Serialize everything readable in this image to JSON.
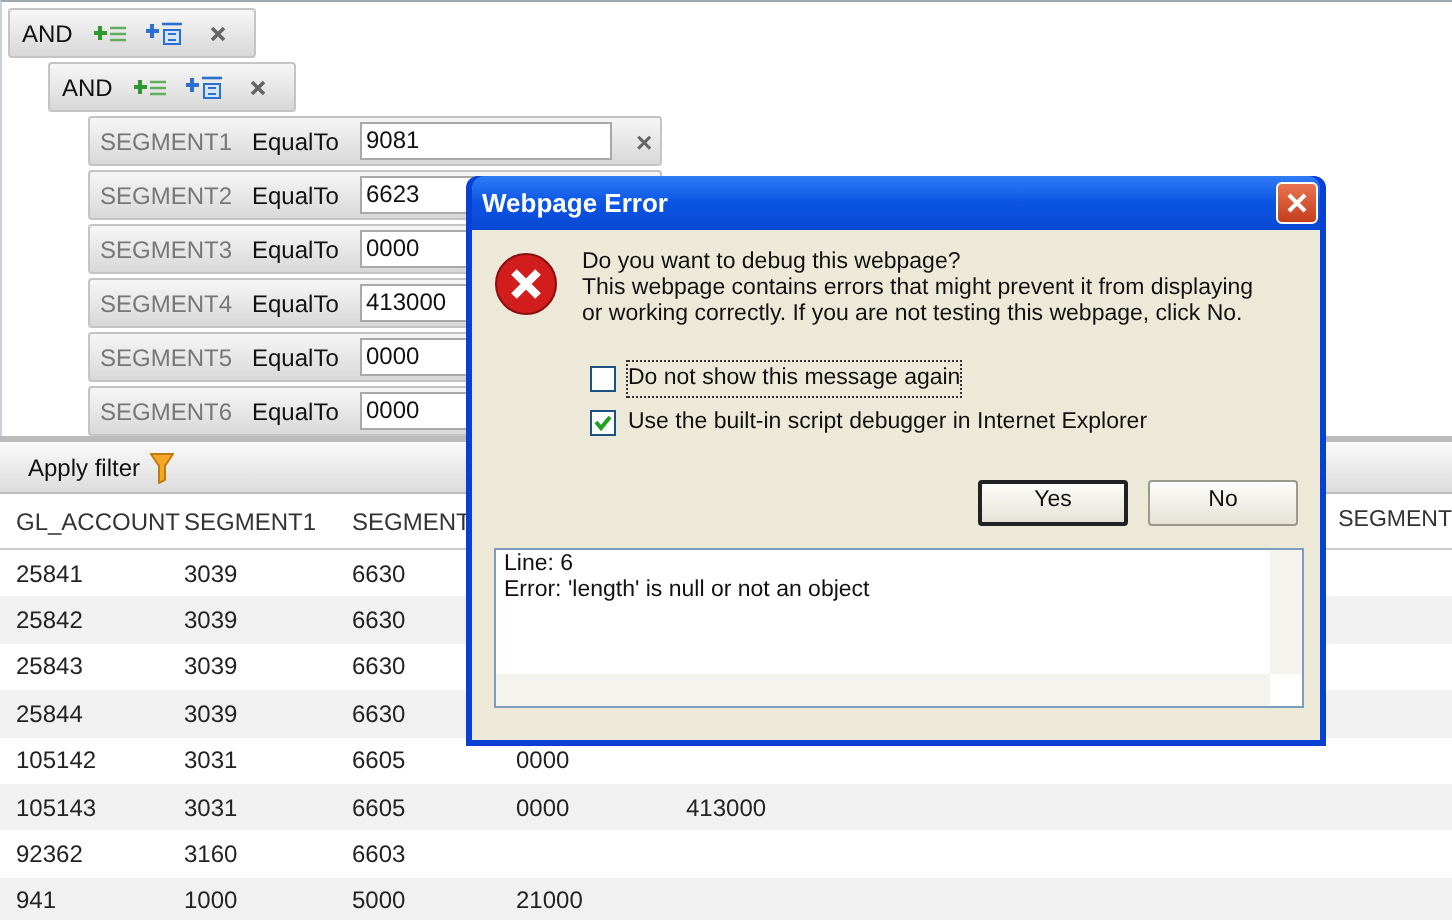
{
  "filter": {
    "operator": "AND",
    "children": [
      {
        "operator": "AND",
        "conditions": [
          {
            "field": "SEGMENT1",
            "operator": "EqualTo",
            "value": "9081",
            "delete": "×"
          },
          {
            "field": "SEGMENT2",
            "operator": "EqualTo",
            "value": "6623"
          },
          {
            "field": "SEGMENT3",
            "operator": "EqualTo",
            "value": "0000"
          },
          {
            "field": "SEGMENT4",
            "operator": "EqualTo",
            "value": "413000"
          },
          {
            "field": "SEGMENT5",
            "operator": "EqualTo",
            "value": "0000"
          },
          {
            "field": "SEGMENT6",
            "operator": "EqualTo",
            "value": "0000"
          }
        ]
      }
    ]
  },
  "toolbar": {
    "apply_label": "Apply filter"
  },
  "table": {
    "columns": [
      "GL_ACCOUNT",
      "SEGMENT1",
      "SEGMENT"
    ],
    "column_right": "SEGMENT",
    "rows": [
      [
        "25841",
        "3039",
        "6630"
      ],
      [
        "25842",
        "3039",
        "6630"
      ],
      [
        "25843",
        "3039",
        "6630"
      ],
      [
        "25844",
        "3039",
        "6630"
      ],
      [
        "105142",
        "3031",
        "6605",
        "0000"
      ],
      [
        "105143",
        "3031",
        "6605",
        "0000",
        "413000"
      ],
      [
        "92362",
        "3160",
        "6603"
      ],
      [
        "941",
        "1000",
        "5000",
        "21000"
      ]
    ]
  },
  "dialog": {
    "title": "Webpage Error",
    "question": "Do you want to debug this webpage?",
    "message": "This webpage contains errors that might prevent it from displaying or working correctly. If you are not testing this webpage, click No.",
    "checkboxes": [
      {
        "label": "Do not show this message again",
        "checked": false,
        "focused": true
      },
      {
        "label": "Use the built-in script debugger in Internet Explorer",
        "checked": true,
        "focused": false
      }
    ],
    "buttons": [
      {
        "label": "Yes",
        "default": true
      },
      {
        "label": "No",
        "default": false
      }
    ],
    "details": [
      "Line: 6",
      "Error: 'length' is null or not an object"
    ]
  }
}
